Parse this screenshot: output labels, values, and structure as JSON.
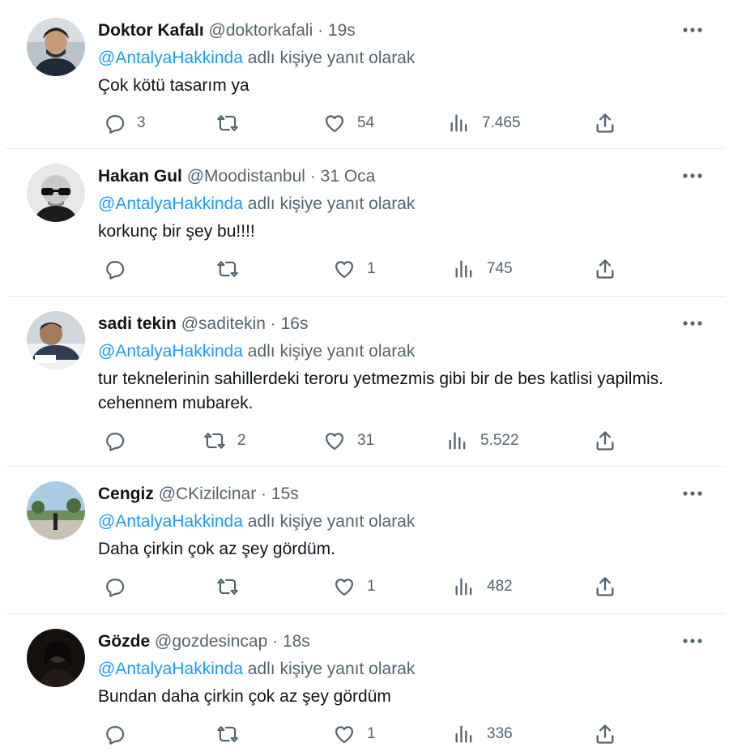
{
  "reply_prefix": "adlı kişiye yanıt olarak",
  "tweets": [
    {
      "name": "Doktor Kafalı",
      "handle": "@doktorkafali",
      "separator": "·",
      "time": "19s",
      "mention": "@AntalyaHakkinda",
      "text": "Çok kötü tasarım ya",
      "replies": "3",
      "retweets": "",
      "likes": "54",
      "views": "7.465"
    },
    {
      "name": "Hakan Gul",
      "handle": "@Moodistanbul",
      "separator": "·",
      "time": "31 Oca",
      "mention": "@AntalyaHakkinda",
      "text": "korkunç bir şey bu!!!!",
      "replies": "",
      "retweets": "",
      "likes": "1",
      "views": "745"
    },
    {
      "name": "sadi tekin",
      "handle": "@saditekin",
      "separator": "·",
      "time": "16s",
      "mention": "@AntalyaHakkinda",
      "text": "tur teknelerinin sahillerdeki teroru yetmezmis gibi bir de bes katlisi yapilmis. cehennem mubarek.",
      "replies": "",
      "retweets": "2",
      "likes": "31",
      "views": "5.522"
    },
    {
      "name": "Cengiz",
      "handle": "@CKizilcinar",
      "separator": "·",
      "time": "15s",
      "mention": "@AntalyaHakkinda",
      "text": "Daha çirkin çok az şey gördüm.",
      "replies": "",
      "retweets": "",
      "likes": "1",
      "views": "482"
    },
    {
      "name": "Gözde",
      "handle": "@gozdesincap",
      "separator": "·",
      "time": "18s",
      "mention": "@AntalyaHakkinda",
      "text": "Bundan daha çirkin çok az şey gördüm",
      "replies": "",
      "retweets": "",
      "likes": "1",
      "views": "336"
    }
  ],
  "colors": {
    "accent": "#1d9bf0",
    "secondary_text": "#536471",
    "primary_text": "#0f1419",
    "divider": "#e7e9ea"
  },
  "icons": [
    "reply-icon",
    "retweet-icon",
    "like-icon",
    "views-icon",
    "share-icon",
    "more-icon"
  ]
}
